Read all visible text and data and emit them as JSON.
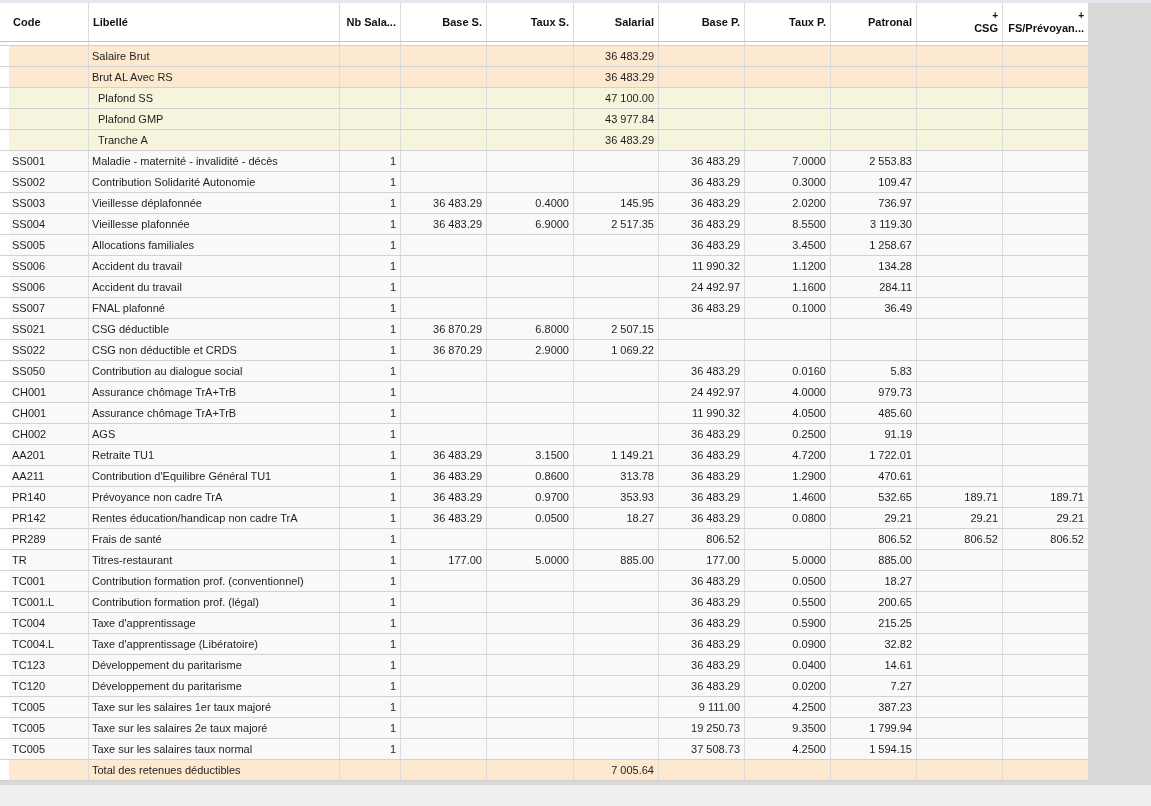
{
  "table": {
    "columns": [
      {
        "label": "Code",
        "kind": "text"
      },
      {
        "label": "Libellé",
        "kind": "text"
      },
      {
        "label": "Nb Sala...",
        "kind": "number"
      },
      {
        "label": "Base S.",
        "kind": "number"
      },
      {
        "label": "Taux S.",
        "kind": "number"
      },
      {
        "label": "Salarial",
        "kind": "number"
      },
      {
        "label": "Base P.",
        "kind": "number"
      },
      {
        "label": "Taux P.",
        "kind": "number"
      },
      {
        "label": "Patronal",
        "kind": "number"
      },
      {
        "label": "CSG",
        "prefix": "+",
        "kind": "number"
      },
      {
        "label": "FS/Prévoyan...",
        "prefix": "+",
        "kind": "number"
      }
    ],
    "rows": [
      {
        "kind": "subtotal",
        "cells": [
          null,
          "Salaire Brut",
          null,
          null,
          null,
          "36 483.29",
          null,
          null,
          null,
          null,
          null
        ]
      },
      {
        "kind": "subtotal",
        "cells": [
          null,
          "Brut AL Avec RS",
          null,
          null,
          null,
          "36 483.29",
          null,
          null,
          null,
          null,
          null
        ]
      },
      {
        "kind": "ceiling",
        "cells": [
          null,
          "Plafond SS",
          null,
          null,
          null,
          "47 100.00",
          null,
          null,
          null,
          null,
          null
        ]
      },
      {
        "kind": "ceiling",
        "cells": [
          null,
          "Plafond GMP",
          null,
          null,
          null,
          "43 977.84",
          null,
          null,
          null,
          null,
          null
        ]
      },
      {
        "kind": "ceiling",
        "cells": [
          null,
          "Tranche A",
          null,
          null,
          null,
          "36 483.29",
          null,
          null,
          null,
          null,
          null
        ]
      },
      {
        "kind": "contribution",
        "cells": [
          "SS001",
          "Maladie - maternité - invalidité - décès",
          "1",
          null,
          null,
          null,
          "36 483.29",
          "7.0000",
          "2 553.83",
          null,
          null
        ]
      },
      {
        "kind": "contribution",
        "cells": [
          "SS002",
          "Contribution Solidarité Autonomie",
          "1",
          null,
          null,
          null,
          "36 483.29",
          "0.3000",
          "109.47",
          null,
          null
        ]
      },
      {
        "kind": "contribution",
        "cells": [
          "SS003",
          "Vieillesse déplafonnée",
          "1",
          "36 483.29",
          "0.4000",
          "145.95",
          "36 483.29",
          "2.0200",
          "736.97",
          null,
          null
        ]
      },
      {
        "kind": "contribution",
        "cells": [
          "SS004",
          "Vieillesse plafonnée",
          "1",
          "36 483.29",
          "6.9000",
          "2 517.35",
          "36 483.29",
          "8.5500",
          "3 119.30",
          null,
          null
        ]
      },
      {
        "kind": "contribution",
        "cells": [
          "SS005",
          "Allocations familiales",
          "1",
          null,
          null,
          null,
          "36 483.29",
          "3.4500",
          "1 258.67",
          null,
          null
        ]
      },
      {
        "kind": "contribution",
        "cells": [
          "SS006",
          "Accident du travail",
          "1",
          null,
          null,
          null,
          "11 990.32",
          "1.1200",
          "134.28",
          null,
          null
        ]
      },
      {
        "kind": "contribution",
        "cells": [
          "SS006",
          "Accident du travail",
          "1",
          null,
          null,
          null,
          "24 492.97",
          "1.1600",
          "284.11",
          null,
          null
        ]
      },
      {
        "kind": "contribution",
        "cells": [
          "SS007",
          "FNAL plafonné",
          "1",
          null,
          null,
          null,
          "36 483.29",
          "0.1000",
          "36.49",
          null,
          null
        ]
      },
      {
        "kind": "contribution",
        "cells": [
          "SS021",
          "CSG déductible",
          "1",
          "36 870.29",
          "6.8000",
          "2 507.15",
          null,
          null,
          null,
          null,
          null
        ]
      },
      {
        "kind": "contribution",
        "cells": [
          "SS022",
          "CSG non déductible et CRDS",
          "1",
          "36 870.29",
          "2.9000",
          "1 069.22",
          null,
          null,
          null,
          null,
          null
        ]
      },
      {
        "kind": "contribution",
        "cells": [
          "SS050",
          "Contribution au dialogue social",
          "1",
          null,
          null,
          null,
          "36 483.29",
          "0.0160",
          "5.83",
          null,
          null
        ]
      },
      {
        "kind": "contribution",
        "cells": [
          "CH001",
          "Assurance chômage TrA+TrB",
          "1",
          null,
          null,
          null,
          "24 492.97",
          "4.0000",
          "979.73",
          null,
          null
        ]
      },
      {
        "kind": "contribution",
        "cells": [
          "CH001",
          "Assurance chômage TrA+TrB",
          "1",
          null,
          null,
          null,
          "11 990.32",
          "4.0500",
          "485.60",
          null,
          null
        ]
      },
      {
        "kind": "contribution",
        "cells": [
          "CH002",
          "AGS",
          "1",
          null,
          null,
          null,
          "36 483.29",
          "0.2500",
          "91.19",
          null,
          null
        ]
      },
      {
        "kind": "contribution",
        "cells": [
          "AA201",
          "Retraite TU1",
          "1",
          "36 483.29",
          "3.1500",
          "1 149.21",
          "36 483.29",
          "4.7200",
          "1 722.01",
          null,
          null
        ]
      },
      {
        "kind": "contribution",
        "cells": [
          "AA211",
          "Contribution d'Equilibre Général TU1",
          "1",
          "36 483.29",
          "0.8600",
          "313.78",
          "36 483.29",
          "1.2900",
          "470.61",
          null,
          null
        ]
      },
      {
        "kind": "contribution",
        "cells": [
          "PR140",
          "Prévoyance non cadre TrA",
          "1",
          "36 483.29",
          "0.9700",
          "353.93",
          "36 483.29",
          "1.4600",
          "532.65",
          "189.71",
          "189.71"
        ]
      },
      {
        "kind": "contribution",
        "cells": [
          "PR142",
          "Rentes éducation/handicap non cadre TrA",
          "1",
          "36 483.29",
          "0.0500",
          "18.27",
          "36 483.29",
          "0.0800",
          "29.21",
          "29.21",
          "29.21"
        ]
      },
      {
        "kind": "contribution",
        "cells": [
          "PR289",
          "Frais de santé",
          "1",
          null,
          null,
          null,
          "806.52",
          null,
          "806.52",
          "806.52",
          "806.52"
        ]
      },
      {
        "kind": "contribution",
        "cells": [
          "TR",
          "Titres-restaurant",
          "1",
          "177.00",
          "5.0000",
          "885.00",
          "177.00",
          "5.0000",
          "885.00",
          null,
          null
        ]
      },
      {
        "kind": "contribution",
        "cells": [
          "TC001",
          "Contribution formation prof. (conventionnel)",
          "1",
          null,
          null,
          null,
          "36 483.29",
          "0.0500",
          "18.27",
          null,
          null
        ]
      },
      {
        "kind": "contribution",
        "cells": [
          "TC001.L",
          "Contribution formation prof. (légal)",
          "1",
          null,
          null,
          null,
          "36 483.29",
          "0.5500",
          "200.65",
          null,
          null
        ]
      },
      {
        "kind": "contribution",
        "cells": [
          "TC004",
          "Taxe d'apprentissage",
          "1",
          null,
          null,
          null,
          "36 483.29",
          "0.5900",
          "215.25",
          null,
          null
        ]
      },
      {
        "kind": "contribution",
        "cells": [
          "TC004.L",
          "Taxe d'apprentissage (Libératoire)",
          "1",
          null,
          null,
          null,
          "36 483.29",
          "0.0900",
          "32.82",
          null,
          null
        ]
      },
      {
        "kind": "contribution",
        "cells": [
          "TC123",
          "Développement du paritarisme",
          "1",
          null,
          null,
          null,
          "36 483.29",
          "0.0400",
          "14.61",
          null,
          null
        ]
      },
      {
        "kind": "contribution",
        "cells": [
          "TC120",
          "Développement du paritarisme",
          "1",
          null,
          null,
          null,
          "36 483.29",
          "0.0200",
          "7.27",
          null,
          null
        ]
      },
      {
        "kind": "contribution",
        "cells": [
          "TC005",
          "Taxe sur les salaires 1er taux majoré",
          "1",
          null,
          null,
          null,
          "9 111.00",
          "4.2500",
          "387.23",
          null,
          null
        ]
      },
      {
        "kind": "contribution",
        "cells": [
          "TC005",
          "Taxe sur les salaires 2e taux majoré",
          "1",
          null,
          null,
          null,
          "19 250.73",
          "9.3500",
          "1 799.94",
          null,
          null
        ]
      },
      {
        "kind": "contribution",
        "cells": [
          "TC005",
          "Taxe sur les salaires taux normal",
          "1",
          null,
          null,
          null,
          "37 508.73",
          "4.2500",
          "1 594.15",
          null,
          null
        ]
      },
      {
        "kind": "subtotal",
        "cells": [
          null,
          "Total des retenues déductibles",
          null,
          null,
          null,
          "7 005.64",
          null,
          null,
          null,
          null,
          null
        ]
      }
    ]
  }
}
